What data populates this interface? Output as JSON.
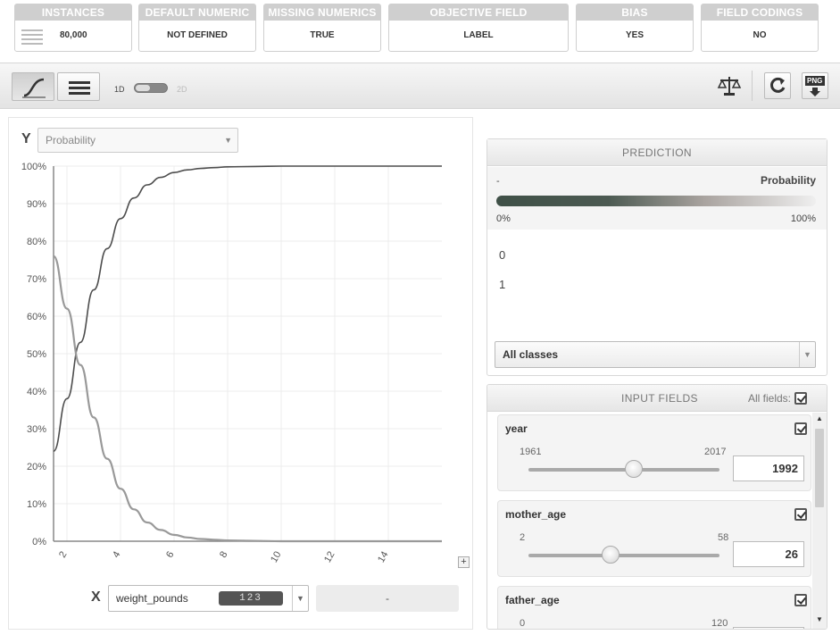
{
  "cards": [
    {
      "header": "INSTANCES",
      "value": "80,000"
    },
    {
      "header": "DEFAULT NUMERIC",
      "value": "NOT DEFINED"
    },
    {
      "header": "MISSING NUMERICS",
      "value": "TRUE"
    },
    {
      "header": "OBJECTIVE FIELD",
      "value": "LABEL"
    },
    {
      "header": "BIAS",
      "value": "YES"
    },
    {
      "header": "FIELD CODINGS",
      "value": "NO"
    }
  ],
  "toolbar": {
    "mode_1d_label": "1D",
    "mode_2d_label": "2D",
    "png_label": "PNG"
  },
  "chart_panel": {
    "y_letter": "Y",
    "y_select": "Probability",
    "x_letter": "X",
    "x_field": "weight_pounds",
    "x_field_type_badge": "123",
    "x_input_value": "-",
    "plus_label": "+"
  },
  "chart_data": {
    "type": "line",
    "xlim": [
      1.5,
      16
    ],
    "ylim": [
      0,
      100
    ],
    "yticks": [
      "0%",
      "10%",
      "20%",
      "30%",
      "40%",
      "50%",
      "60%",
      "70%",
      "80%",
      "90%",
      "100%"
    ],
    "xticks": [
      "2",
      "4",
      "6",
      "8",
      "10",
      "12",
      "14"
    ],
    "x": [
      1.5,
      2.0,
      2.5,
      3.0,
      3.5,
      4.0,
      4.5,
      5.0,
      5.5,
      6.0,
      6.5,
      7.0,
      7.5,
      8.0,
      9.0,
      10.0,
      11.0,
      12.0,
      14.0,
      16.0
    ],
    "series": [
      {
        "color": "#4d4d4d",
        "values": [
          24,
          38,
          53,
          67,
          78,
          86,
          91.5,
          95,
          97,
          98.3,
          99,
          99.4,
          99.6,
          99.8,
          99.9,
          100,
          100,
          100,
          100,
          100
        ]
      },
      {
        "color": "#999999",
        "values": [
          76,
          62,
          47,
          33,
          22,
          14,
          8.5,
          5,
          3,
          1.7,
          1,
          0.6,
          0.4,
          0.2,
          0.1,
          0,
          0,
          0,
          0,
          0
        ]
      }
    ],
    "grid": true
  },
  "prediction": {
    "header": "PREDICTION",
    "left_label": "-",
    "right_label": "Probability",
    "scale_min": "0%",
    "scale_max": "100%",
    "classes": [
      "0",
      "1"
    ],
    "class_select": "All classes"
  },
  "input_fields": {
    "header": "INPUT FIELDS",
    "all_fields_label": "All fields:",
    "fields": [
      {
        "name": "year",
        "min": "1961",
        "max": "2017",
        "value": "1992",
        "level": 0.55
      },
      {
        "name": "mother_age",
        "min": "2",
        "max": "58",
        "value": "26",
        "level": 0.43
      },
      {
        "name": "father_age",
        "min": "0",
        "max": "120",
        "value": "",
        "level": 0.3
      }
    ]
  }
}
